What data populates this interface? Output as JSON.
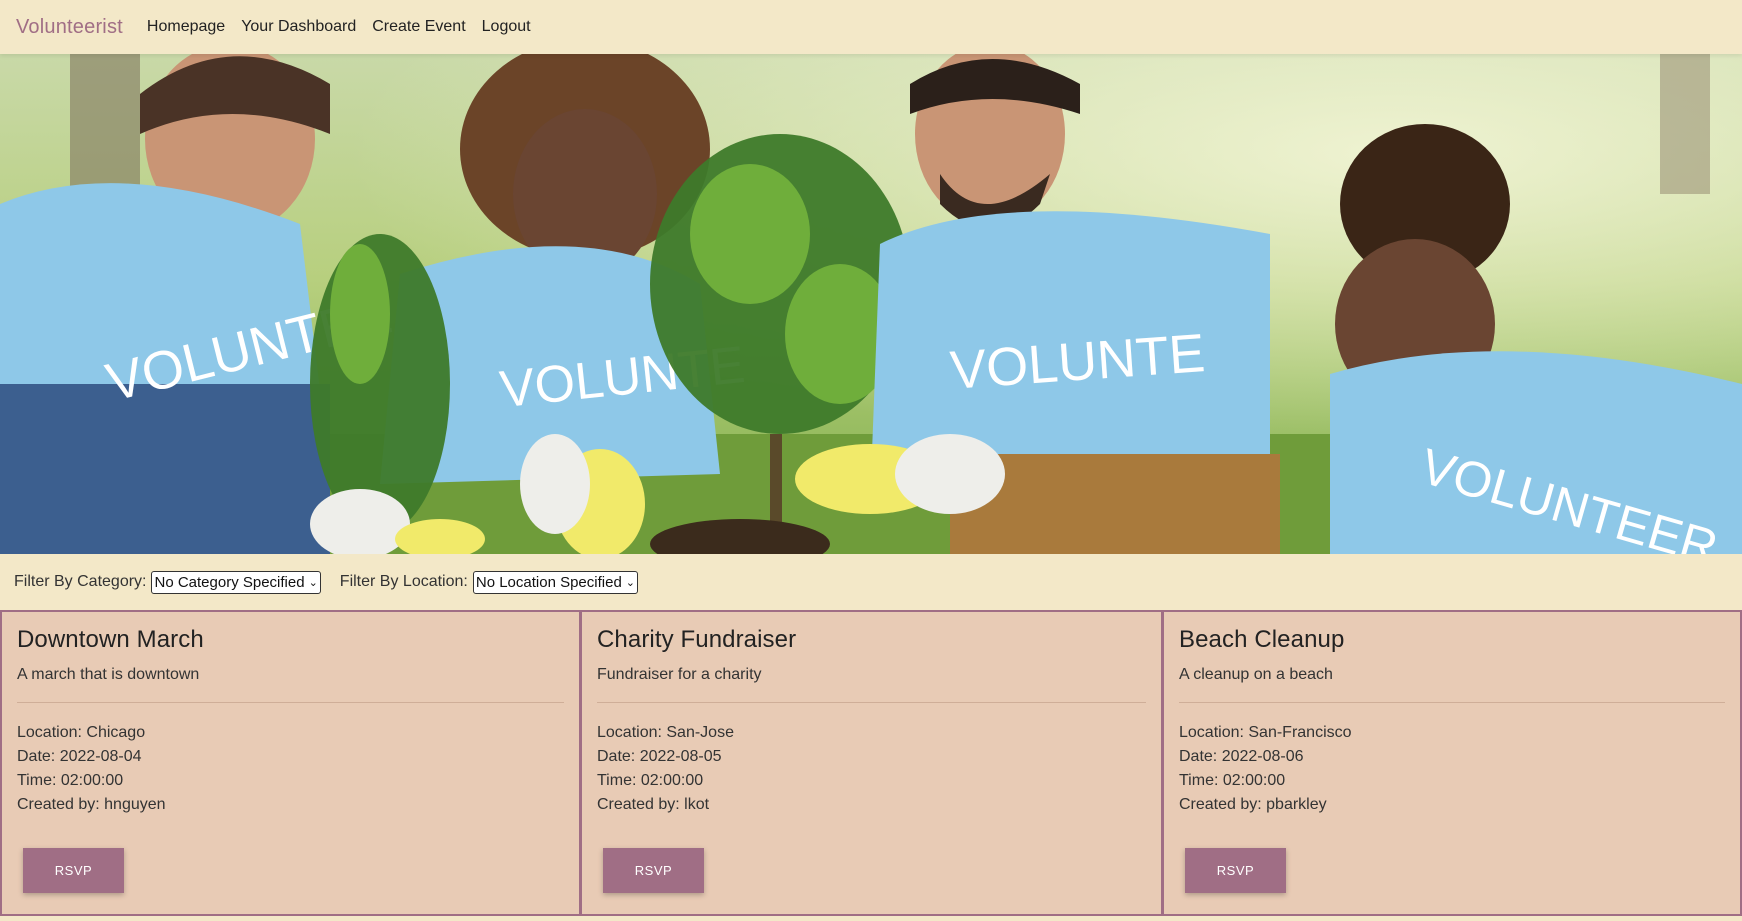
{
  "navbar": {
    "brand": "Volunteerist",
    "links": [
      "Homepage",
      "Your Dashboard",
      "Create Event",
      "Logout"
    ]
  },
  "hero": {
    "shirt_texts": [
      "VOLUNTEE",
      "VOLUNTE",
      "VOLUNTEER"
    ]
  },
  "filters": {
    "category_label": "Filter By Category:",
    "category_value": "No Category Specified",
    "location_label": "Filter By Location:",
    "location_value": "No Location Specified"
  },
  "events": [
    {
      "title": "Downtown March",
      "description": "A march that is downtown",
      "location": "Location: Chicago",
      "date": "Date: 2022-08-04",
      "time": "Time: 02:00:00",
      "created_by": "Created by: hnguyen",
      "button": "RSVP"
    },
    {
      "title": "Charity Fundraiser",
      "description": "Fundraiser for a charity",
      "location": "Location: San-Jose",
      "date": "Date: 2022-08-05",
      "time": "Time: 02:00:00",
      "created_by": "Created by: lkot",
      "button": "RSVP"
    },
    {
      "title": "Beach Cleanup",
      "description": "A cleanup on a beach",
      "location": "Location: San-Francisco",
      "date": "Date: 2022-08-06",
      "time": "Time: 02:00:00",
      "created_by": "Created by: pbarkley",
      "button": "RSVP"
    }
  ],
  "colors": {
    "background": "#f3e8c8",
    "brand": "#a06e85",
    "card_bg": "#e8cbb5",
    "button": "#a06e85",
    "shirt": "#8ec8e8"
  }
}
